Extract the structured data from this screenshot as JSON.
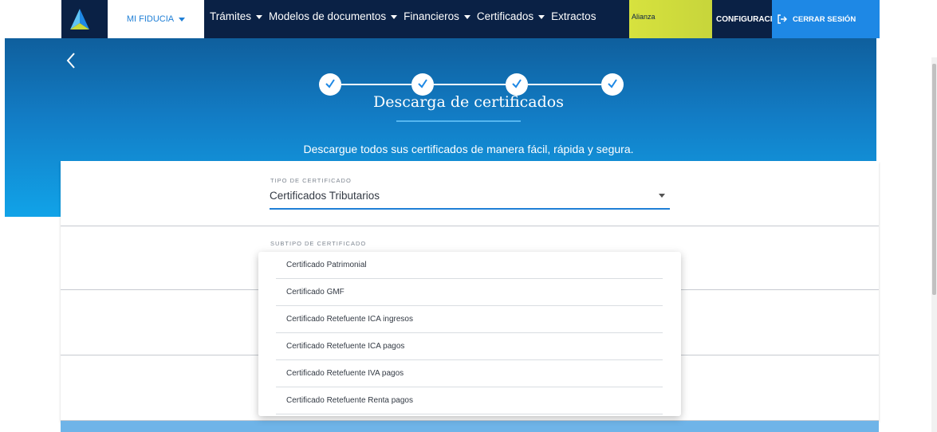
{
  "nav": {
    "brand_menu": "MI FIDUCIA",
    "items": [
      "Trámites",
      "Modelos de documentos",
      "Financieros",
      "Certificados",
      "Extractos"
    ],
    "banner_label": "Alianza",
    "config_label": "CONFIGURACIÓN",
    "logout_label": "CERRAR SESIÓN"
  },
  "hero": {
    "title": "Descarga de certificados",
    "subtitle": "Descargue todos sus certificados de manera fácil, rápida y segura.",
    "steps_completed": 4
  },
  "form": {
    "tipo_label": "TIPO DE CERTIFICADO",
    "tipo_value": "Certificados Tributarios",
    "subtipo_label": "SUBTIPO DE CERTIFICADO"
  },
  "dropdown": {
    "options": [
      "Certificado Patrimonial",
      "Certificado GMF",
      "Certificado Retefuente ICA ingresos",
      "Certificado Retefuente ICA pagos",
      "Certificado Retefuente IVA pagos",
      "Certificado Retefuente Renta pagos"
    ]
  },
  "colors": {
    "nav_dark": "#0a2145",
    "accent_blue": "#1e88e5",
    "banner_yellow": "#d7e23e",
    "hero_top": "#0f5f9d",
    "hero_bottom": "#11a3e8"
  },
  "icons": {
    "logo": "alianza-logo-icon",
    "back": "chevron-left-icon",
    "logout": "logout-icon",
    "step": "check-icon"
  }
}
